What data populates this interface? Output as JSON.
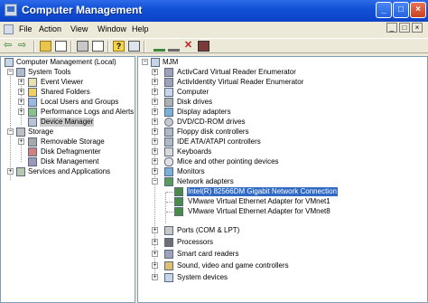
{
  "window": {
    "title": "Computer Management"
  },
  "menu": [
    "File",
    "Action",
    "View",
    "Window",
    "Help"
  ],
  "left_tree": {
    "root": "Computer Management (Local)",
    "system_tools": "System Tools",
    "event_viewer": "Event Viewer",
    "shared_folders": "Shared Folders",
    "local_users": "Local Users and Groups",
    "perf_logs": "Performance Logs and Alerts",
    "device_manager": "Device Manager",
    "storage": "Storage",
    "removable_storage": "Removable Storage",
    "disk_defrag": "Disk Defragmenter",
    "disk_mgmt": "Disk Management",
    "services_apps": "Services and Applications"
  },
  "right_tree": {
    "root": "MJM",
    "categories": [
      "ActivCard Virtual Reader Enumerator",
      "ActivIdentity Virtual Reader Enumerator",
      "Computer",
      "Disk drives",
      "Display adapters",
      "DVD/CD-ROM drives",
      "Floppy disk controllers",
      "IDE ATA/ATAPI controllers",
      "Keyboards",
      "Mice and other pointing devices",
      "Monitors",
      "Network adapters"
    ],
    "network_children": [
      "Intel(R) 82566DM Gigabit Network Connection",
      "VMware Virtual Ethernet Adapter for VMnet1",
      "VMware Virtual Ethernet Adapter for VMnet8"
    ],
    "categories_after": [
      "Ports (COM & LPT)",
      "Processors",
      "Smart card readers",
      "Sound, video and game controllers",
      "System devices"
    ]
  },
  "colors": {
    "title_bar": "#0c43c8",
    "selection": "#316ac5",
    "inactive_selection": "#cccccc",
    "pane_border": "#7f9db9"
  }
}
